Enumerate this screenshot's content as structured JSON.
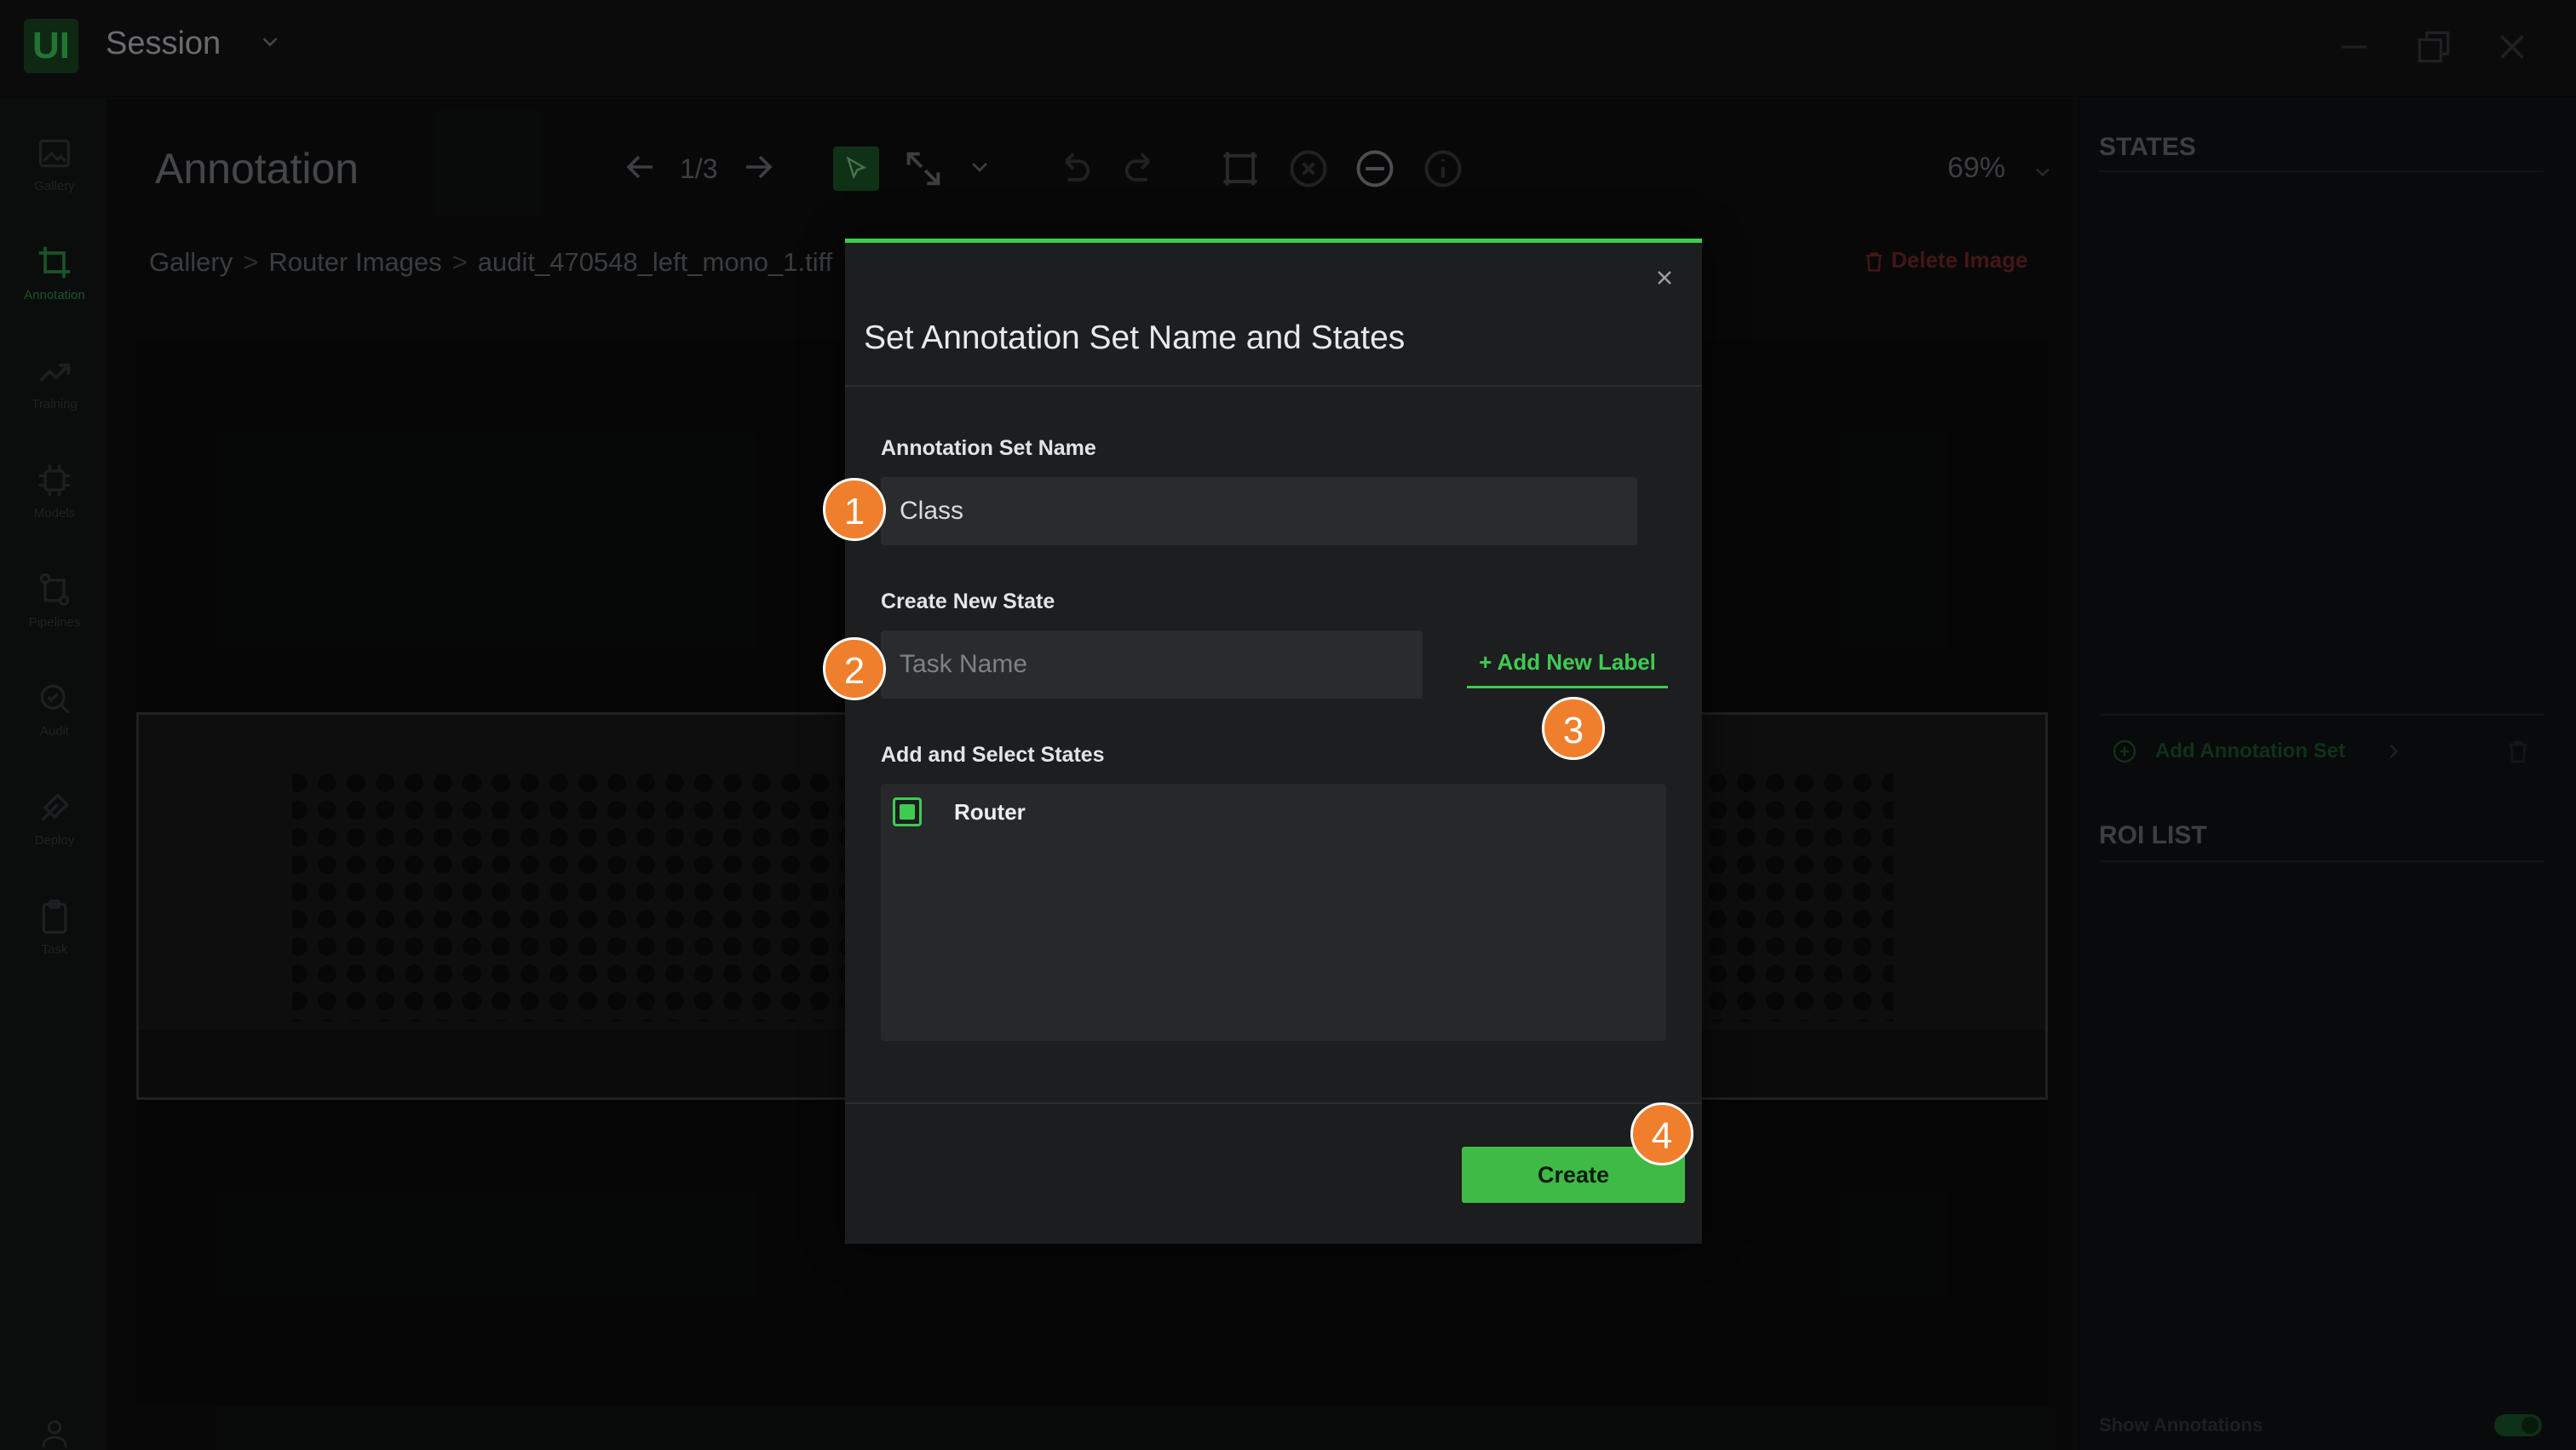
{
  "app": {
    "logo_text": "UI",
    "session_title": "Session",
    "window_controls": [
      "minimize-icon",
      "restore-icon",
      "close-icon"
    ]
  },
  "sidebar": {
    "items": [
      {
        "label": "Gallery",
        "icon": "gallery-icon",
        "active": false
      },
      {
        "label": "Annotation",
        "icon": "crop-icon",
        "active": true
      },
      {
        "label": "Training",
        "icon": "trend-icon",
        "active": false
      },
      {
        "label": "Models",
        "icon": "chip-icon",
        "active": false
      },
      {
        "label": "Pipelines",
        "icon": "pipeline-icon",
        "active": false
      },
      {
        "label": "Audit",
        "icon": "audit-icon",
        "active": false
      },
      {
        "label": "Deploy",
        "icon": "deploy-icon",
        "active": false
      },
      {
        "label": "Task",
        "icon": "clipboard-icon",
        "active": false
      }
    ]
  },
  "main": {
    "page_title": "Annotation",
    "pager": "1/3",
    "zoom": "69%",
    "breadcrumb": [
      "Gallery",
      "Router Images",
      "audit_470548_left_mono_1.tiff"
    ],
    "breadcrumb_sep": ">",
    "delete_image": "Delete Image"
  },
  "right_panel": {
    "states_heading": "STATES",
    "add_annotation_set": "Add Annotation Set",
    "roi_heading": "ROI LIST",
    "show_annotations": "Show Annotations",
    "show_annotations_on": true
  },
  "modal": {
    "title": "Set Annotation Set Name and States",
    "set_name_label": "Annotation Set Name",
    "set_name_value": "Class",
    "new_state_label": "Create New State",
    "task_placeholder": "Task Name",
    "add_label_button": "+ Add New Label",
    "select_states_label": "Add and Select States",
    "states": [
      {
        "name": "Router",
        "checked": true
      }
    ],
    "create_button": "Create"
  },
  "badges": [
    "1",
    "2",
    "3",
    "4"
  ],
  "colors": {
    "accent_green": "#3ecb52",
    "badge_orange": "#ef7f2c",
    "background": "#121314",
    "modal_bg": "#1d1e20",
    "danger": "#7a2a2a"
  }
}
